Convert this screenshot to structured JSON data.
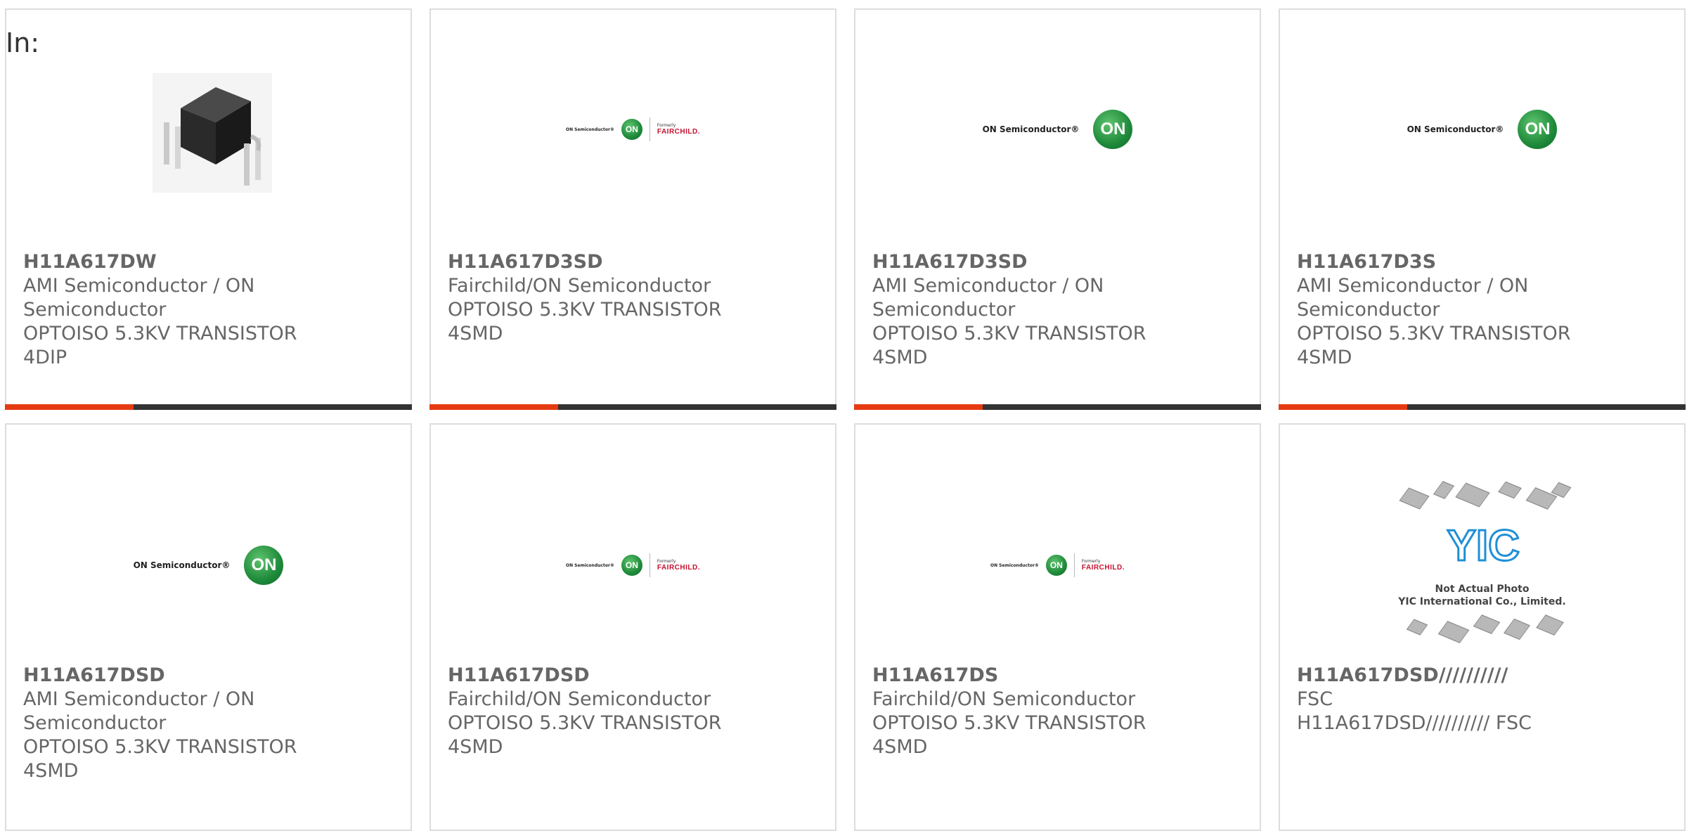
{
  "in_label": "In:",
  "colors": {
    "accent": "#e63a12",
    "bar": "#333333",
    "border": "#dddddd",
    "text": "#666666"
  },
  "products": [
    {
      "part_number": "H11A617DW",
      "manufacturer": "AMI Semiconductor / ON Semiconductor",
      "description": "OPTOISO 5.3KV TRANSISTOR 4DIP",
      "image": "component-photo"
    },
    {
      "part_number": "H11A617D3SD",
      "manufacturer": "Fairchild/ON Semiconductor",
      "description": "OPTOISO 5.3KV TRANSISTOR 4SMD",
      "image": "on-fairchild-logo"
    },
    {
      "part_number": "H11A617D3SD",
      "manufacturer": "AMI Semiconductor / ON Semiconductor",
      "description": "OPTOISO 5.3KV TRANSISTOR 4SMD",
      "image": "on-semiconductor-logo"
    },
    {
      "part_number": "H11A617D3S",
      "manufacturer": "AMI Semiconductor / ON Semiconductor",
      "description": "OPTOISO 5.3KV TRANSISTOR 4SMD",
      "image": "on-semiconductor-logo"
    },
    {
      "part_number": "H11A617DSD",
      "manufacturer": "AMI Semiconductor / ON Semiconductor",
      "description": "OPTOISO 5.3KV TRANSISTOR 4SMD",
      "image": "on-semiconductor-logo"
    },
    {
      "part_number": "H11A617DSD",
      "manufacturer": "Fairchild/ON Semiconductor",
      "description": "OPTOISO 5.3KV TRANSISTOR 4SMD",
      "image": "on-fairchild-logo"
    },
    {
      "part_number": "H11A617DS",
      "manufacturer": "Fairchild/ON Semiconductor",
      "description": "OPTOISO 5.3KV TRANSISTOR 4SMD",
      "image": "on-fairchild-logo"
    },
    {
      "part_number": "H11A617DSD//////////",
      "manufacturer": "FSC",
      "description": "H11A617DSD////////// FSC",
      "image": "yic-placeholder"
    }
  ],
  "logos": {
    "on_text": "ON Semiconductor®",
    "on_mark": "ON",
    "formerly": "Formerly",
    "fairchild": "FAIRCHILD.",
    "yic_letters": "YIC",
    "yic_caption_1": "Not Actual Photo",
    "yic_caption_2": "YIC International Co., Limited."
  }
}
